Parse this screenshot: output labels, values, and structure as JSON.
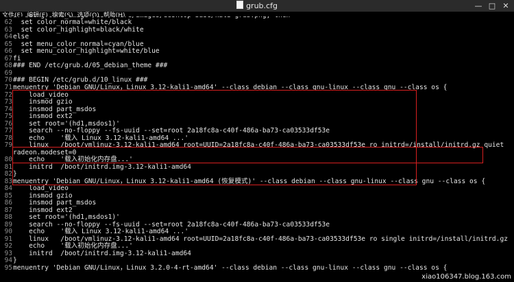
{
  "window": {
    "title": "grub.cfg",
    "controls": {
      "minimize": "—",
      "maximize": "□",
      "close": "✕"
    }
  },
  "menu": [
    "文件(F)",
    "编辑(E)",
    "搜索(S)",
    "选项(O)",
    "帮助(H)"
  ],
  "lines": [
    {
      "num": "61",
      "text": "if background_image /usr/share/images/desktop-base/kali-grub.png; then"
    },
    {
      "num": "62",
      "text": "  set color_normal=white/black"
    },
    {
      "num": "63",
      "text": "  set color_highlight=black/white"
    },
    {
      "num": "64",
      "text": "else"
    },
    {
      "num": "65",
      "text": "  set menu_color_normal=cyan/blue"
    },
    {
      "num": "66",
      "text": "  set menu_color_highlight=white/blue"
    },
    {
      "num": "67",
      "text": "fi"
    },
    {
      "num": "68",
      "text": "### END /etc/grub.d/05_debian_theme ###"
    },
    {
      "num": "69",
      "text": ""
    },
    {
      "num": "70",
      "text": "### BEGIN /etc/grub.d/10_linux ###"
    },
    {
      "num": "71",
      "text": "menuentry 'Debian GNU/Linux，Linux 3.12-kali1-amd64' --class debian --class gnu-linux --class gnu --class os {"
    },
    {
      "num": "72",
      "text": "    load_video"
    },
    {
      "num": "73",
      "text": "    insmod gzio"
    },
    {
      "num": "74",
      "text": "    insmod part_msdos"
    },
    {
      "num": "75",
      "text": "    insmod ext2"
    },
    {
      "num": "76",
      "text": "    set root='(hd1,msdos1)'"
    },
    {
      "num": "77",
      "text": "    search --no-floppy --fs-uuid --set=root 2a18fc8a-c40f-486a-ba73-ca03533df53e"
    },
    {
      "num": "78",
      "text": "    echo    '载入 Linux 3.12-kali1-amd64 ...'"
    },
    {
      "num": "79",
      "text": "    linux   /boot/vmlinuz-3.12-kali1-amd64 root=UUID=2a18fc8a-c40f-486a-ba73-ca03533df53e ro initrd=/install/initrd.gz quiet"
    },
    {
      "num": "",
      "text": "radeon.modeset=0"
    },
    {
      "num": "80",
      "text": "    echo    '载入初始化内存盘...'"
    },
    {
      "num": "81",
      "text": "    initrd  /boot/initrd.img-3.12-kali1-amd64"
    },
    {
      "num": "82",
      "text": "}"
    },
    {
      "num": "83",
      "text": "menuentry 'Debian GNU/Linux，Linux 3.12-kali1-amd64 (恢复模式)' --class debian --class gnu-linux --class gnu --class os {"
    },
    {
      "num": "84",
      "text": "    load_video"
    },
    {
      "num": "85",
      "text": "    insmod gzio"
    },
    {
      "num": "86",
      "text": "    insmod part_msdos"
    },
    {
      "num": "87",
      "text": "    insmod ext2"
    },
    {
      "num": "88",
      "text": "    set root='(hd1,msdos1)'"
    },
    {
      "num": "89",
      "text": "    search --no-floppy --fs-uuid --set=root 2a18fc8a-c40f-486a-ba73-ca03533df53e"
    },
    {
      "num": "90",
      "text": "    echo    '载入 Linux 3.12-kali1-amd64 ...'"
    },
    {
      "num": "91",
      "text": "    linux   /boot/vmlinuz-3.12-kali1-amd64 root=UUID=2a18fc8a-c40f-486a-ba73-ca03533df53e ro single initrd=/install/initrd.gz"
    },
    {
      "num": "92",
      "text": "    echo    '载入初始化内存盘...'"
    },
    {
      "num": "93",
      "text": "    initrd  /boot/initrd.img-3.12-kali1-amd64"
    },
    {
      "num": "94",
      "text": "}"
    },
    {
      "num": "95",
      "text": "menuentry 'Debian GNU/Linux，Linux 3.2.0-4-rt-amd64' --class debian --class gnu-linux --class gnu --class os {"
    }
  ],
  "watermark": "xiao106347.blog.163.com",
  "colors": {
    "highlight_box": "#d82020",
    "background": "#000000",
    "text": "#e6e6e6"
  }
}
